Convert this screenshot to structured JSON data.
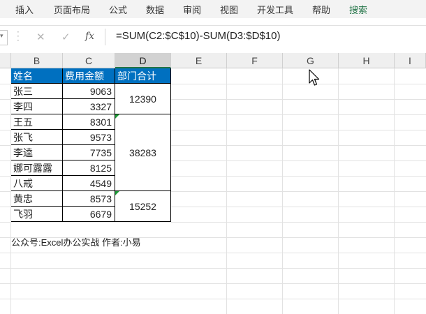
{
  "ribbon": {
    "tabs": [
      "插入",
      "页面布局",
      "公式",
      "数据",
      "审阅",
      "视图",
      "开发工具",
      "帮助",
      "搜索"
    ]
  },
  "formula_bar": {
    "cancel_symbol": "✕",
    "confirm_symbol": "✓",
    "fx_label": "fx",
    "formula": "=SUM(C2:$C$10)-SUM(D3:$D$10)"
  },
  "columns": [
    "B",
    "C",
    "D",
    "E",
    "F",
    "G",
    "H",
    "I"
  ],
  "selected_column": "D",
  "table": {
    "headers": [
      "姓名",
      "费用金额",
      "部门合计"
    ],
    "rows": [
      {
        "name": "张三",
        "amount": "9063"
      },
      {
        "name": "李四",
        "amount": "3327"
      },
      {
        "name": "王五",
        "amount": "8301"
      },
      {
        "name": "张飞",
        "amount": "9573"
      },
      {
        "name": "李逵",
        "amount": "7735"
      },
      {
        "name": "娜可露露",
        "amount": "8125"
      },
      {
        "name": "八戒",
        "amount": "4549"
      },
      {
        "name": "黄忠",
        "amount": "8573"
      },
      {
        "name": "飞羽",
        "amount": "6679"
      }
    ],
    "department_totals": [
      {
        "value": "12390",
        "rows": 2
      },
      {
        "value": "38283",
        "rows": 5
      },
      {
        "value": "15252",
        "rows": 2
      }
    ]
  },
  "footer": "公众号:Excel办公实战  作者:小易",
  "colors": {
    "header_fill": "#0070c0",
    "error_indicator": "#1d9b37",
    "search_tab": "#217346"
  }
}
